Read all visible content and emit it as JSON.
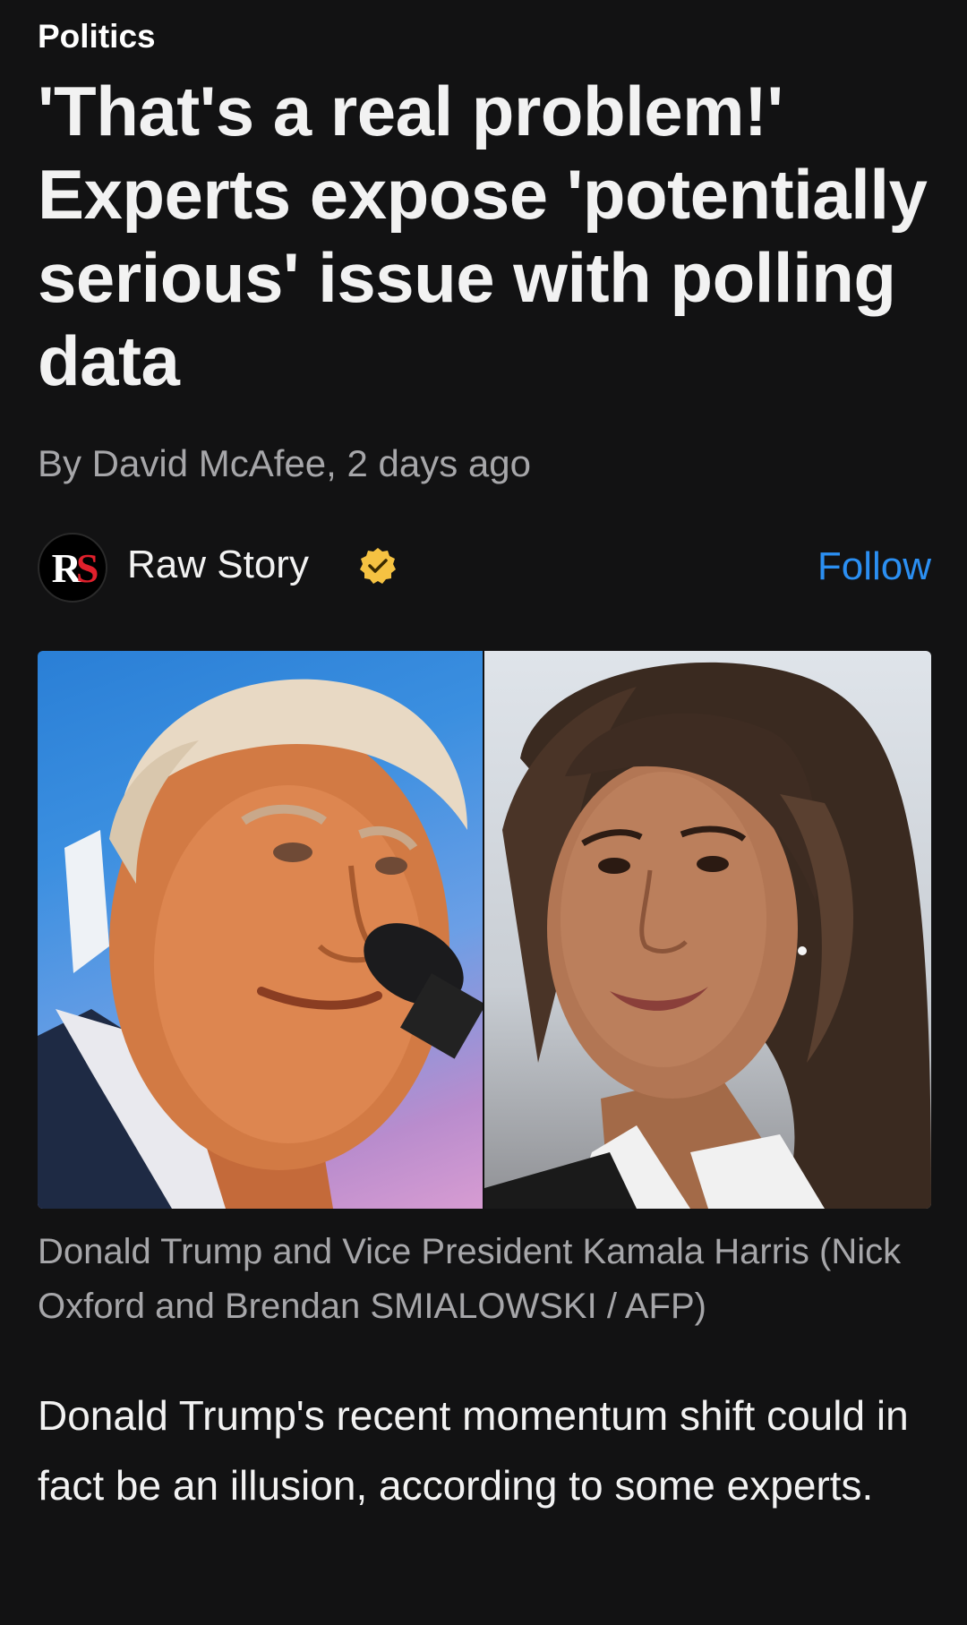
{
  "article": {
    "category": "Politics",
    "headline": "'That's a real problem!' Experts expose 'potentially serious' issue with polling data",
    "byline": "By David McAfee, 2 days ago"
  },
  "source": {
    "logo_text_r": "R",
    "logo_text_s": "S",
    "name": "Raw Story",
    "verified_icon": "verified-badge-icon",
    "follow_label": "Follow"
  },
  "image": {
    "caption": "Donald Trump and Vice President Kamala Harris (Nick Oxford and Brendan SMIALOWSKI / AFP)"
  },
  "body": {
    "paragraph_1": "Donald Trump's recent momentum shift could in fact be an illusion, according to some experts."
  },
  "colors": {
    "background": "#121213",
    "accent": "#2b8ff2",
    "muted_text": "#a6a6a9",
    "verified_badge": "#f5c242",
    "logo_red": "#e0202c"
  }
}
